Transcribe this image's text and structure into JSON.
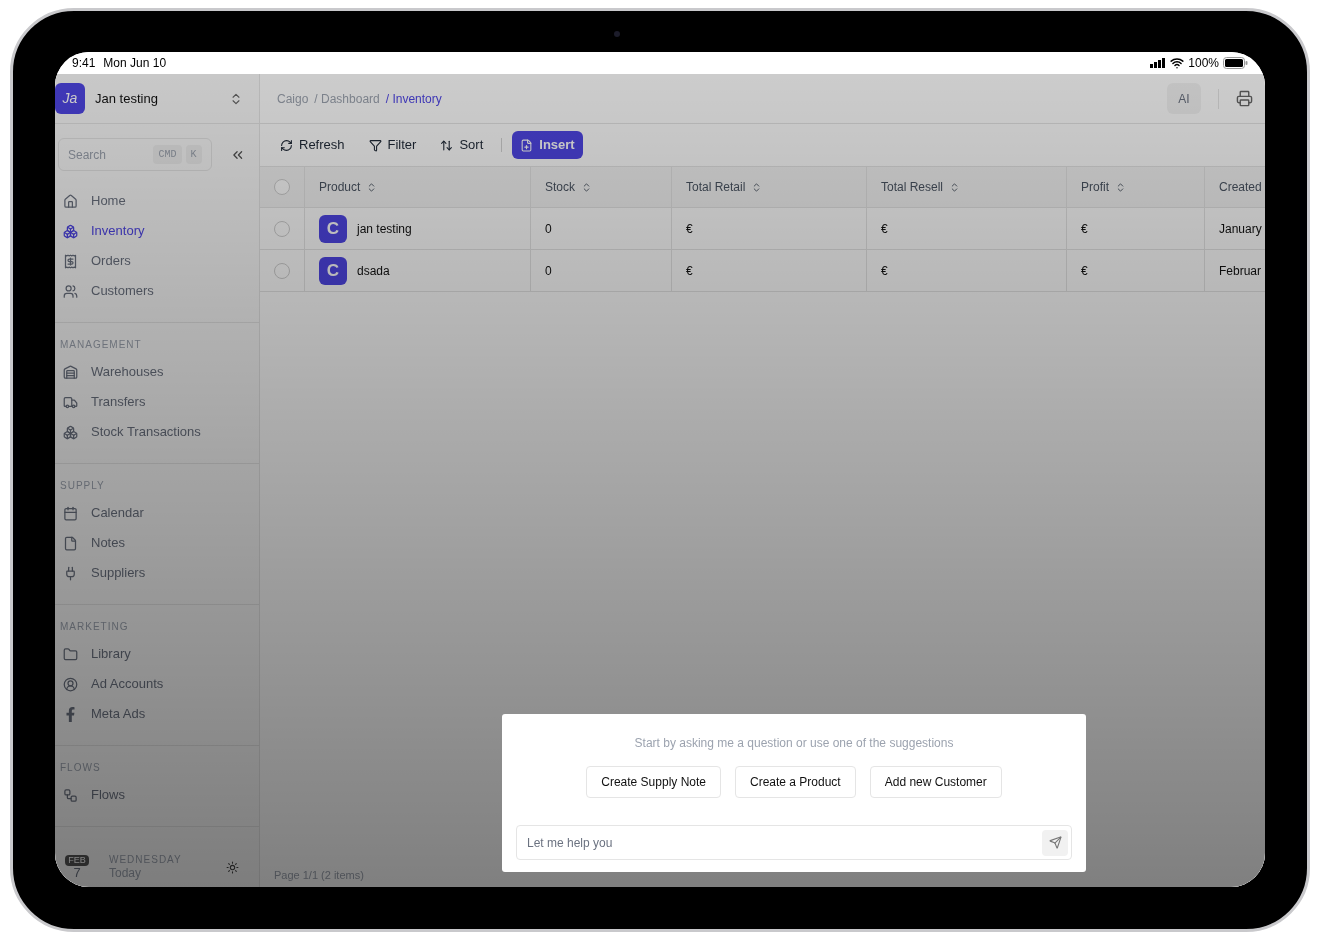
{
  "status_bar": {
    "time": "9:41",
    "date": "Mon Jun 10",
    "battery": "100%"
  },
  "sidebar": {
    "workspace": {
      "initials": "Ja",
      "name": "Jan testing"
    },
    "search": {
      "placeholder": "Search",
      "keys": [
        "CMD",
        "K"
      ]
    },
    "nav": [
      {
        "label": "Home",
        "selected": false
      },
      {
        "label": "Inventory",
        "selected": true
      },
      {
        "label": "Orders",
        "selected": false
      },
      {
        "label": "Customers",
        "selected": false
      }
    ],
    "sections": [
      {
        "title": "MANAGEMENT",
        "items": [
          "Warehouses",
          "Transfers",
          "Stock Transactions"
        ]
      },
      {
        "title": "SUPPLY",
        "items": [
          "Calendar",
          "Notes",
          "Suppliers"
        ]
      },
      {
        "title": "MARKETING",
        "items": [
          "Library",
          "Ad Accounts",
          "Meta Ads"
        ]
      },
      {
        "title": "FLOWS",
        "items": [
          "Flows"
        ]
      }
    ],
    "footer": {
      "month": "FEB",
      "day": "7",
      "weekday": "WEDNESDAY",
      "relative": "Today"
    }
  },
  "breadcrumbs": [
    {
      "label": "Caigo",
      "selected": false
    },
    {
      "label": "/ Dashboard",
      "selected": false
    },
    {
      "label": "/ Inventory",
      "selected": true
    }
  ],
  "header": {
    "ai_button": "AI"
  },
  "toolbar": [
    {
      "label": "Refresh",
      "kind": "plain"
    },
    {
      "label": "Filter",
      "kind": "plain"
    },
    {
      "label": "Sort",
      "kind": "plain"
    },
    {
      "label": "Insert",
      "kind": "primary"
    }
  ],
  "table": {
    "select_all": {
      "checked": false
    },
    "columns": [
      "Product",
      "Stock",
      "Total Retail",
      "Total Resell",
      "Profit",
      "Created"
    ],
    "rows": [
      {
        "selected": false,
        "avatar": "C",
        "cells": [
          "jan testing",
          "0",
          "€",
          "€",
          "€",
          "January"
        ]
      },
      {
        "selected": false,
        "avatar": "C",
        "cells": [
          "dsada",
          "0",
          "€",
          "€",
          "€",
          "Februar"
        ]
      }
    ]
  },
  "pagination": "Page 1/1 (2 items)",
  "assistant": {
    "prompt": "Start by asking me a question or use one of the suggestions",
    "suggestions": [
      "Create Supply Note",
      "Create a Product",
      "Add new Customer"
    ],
    "placeholder": "Let me help you"
  }
}
